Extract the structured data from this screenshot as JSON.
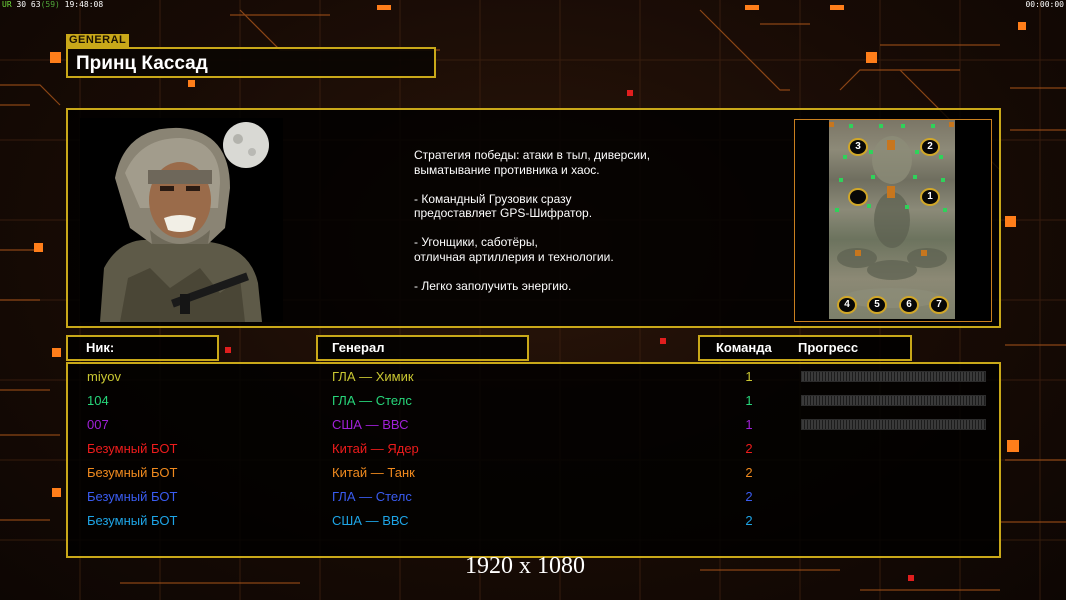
{
  "hud": {
    "left_status": "UR",
    "left_values": "30 63",
    "left_paren": "(59)",
    "left_time": "19:48:08",
    "right_time": "00:00:00"
  },
  "general": {
    "tag": "GENERAL",
    "name": "Принц Кассад"
  },
  "strategy_text": "Стратегия победы: атаки в тыл, диверсии,\n выматывание противника и хаос.\n\n- Командный Грузовик сразу\nпредоставляет GPS-Шифратор.\n\n- Угонщики, саботёры,\nотличная артиллерия и технологии.\n\n- Легко заполучить энергию.",
  "minimap": {
    "slots": [
      "3",
      "2",
      "",
      "1",
      "4",
      "5",
      "6",
      "7"
    ]
  },
  "columns": {
    "nick": "Ник:",
    "general": "Генерал",
    "team": "Команда",
    "progress": "Прогресс"
  },
  "players": [
    {
      "nick": "miyov",
      "general": "ГЛА — Химик",
      "team": "1",
      "color": "#c9c732",
      "progress_visible": true
    },
    {
      "nick": "104",
      "general": "ГЛА — Стелс",
      "team": "1",
      "color": "#27d67a",
      "progress_visible": true
    },
    {
      "nick": "007",
      "general": "США — ВВС",
      "team": "1",
      "color": "#a020d8",
      "progress_visible": true
    },
    {
      "nick": "Безумный БОТ",
      "general": "Китай — Ядер",
      "team": "2",
      "color": "#ee1c1c",
      "progress_visible": false
    },
    {
      "nick": "Безумный БОТ",
      "general": "Китай — Танк",
      "team": "2",
      "color": "#f08a1e",
      "progress_visible": false
    },
    {
      "nick": "Безумный БОТ",
      "general": "ГЛА — Стелс",
      "team": "2",
      "color": "#3a5cf0",
      "progress_visible": false
    },
    {
      "nick": "Безумный БОТ",
      "general": "США — ВВС",
      "team": "2",
      "color": "#1ea5e6",
      "progress_visible": false
    }
  ],
  "overlay": {
    "resolution": "1920 x 1080"
  },
  "colors": {
    "accent": "#c9a819",
    "map_border": "#c97f1f",
    "background": "#180b05"
  }
}
